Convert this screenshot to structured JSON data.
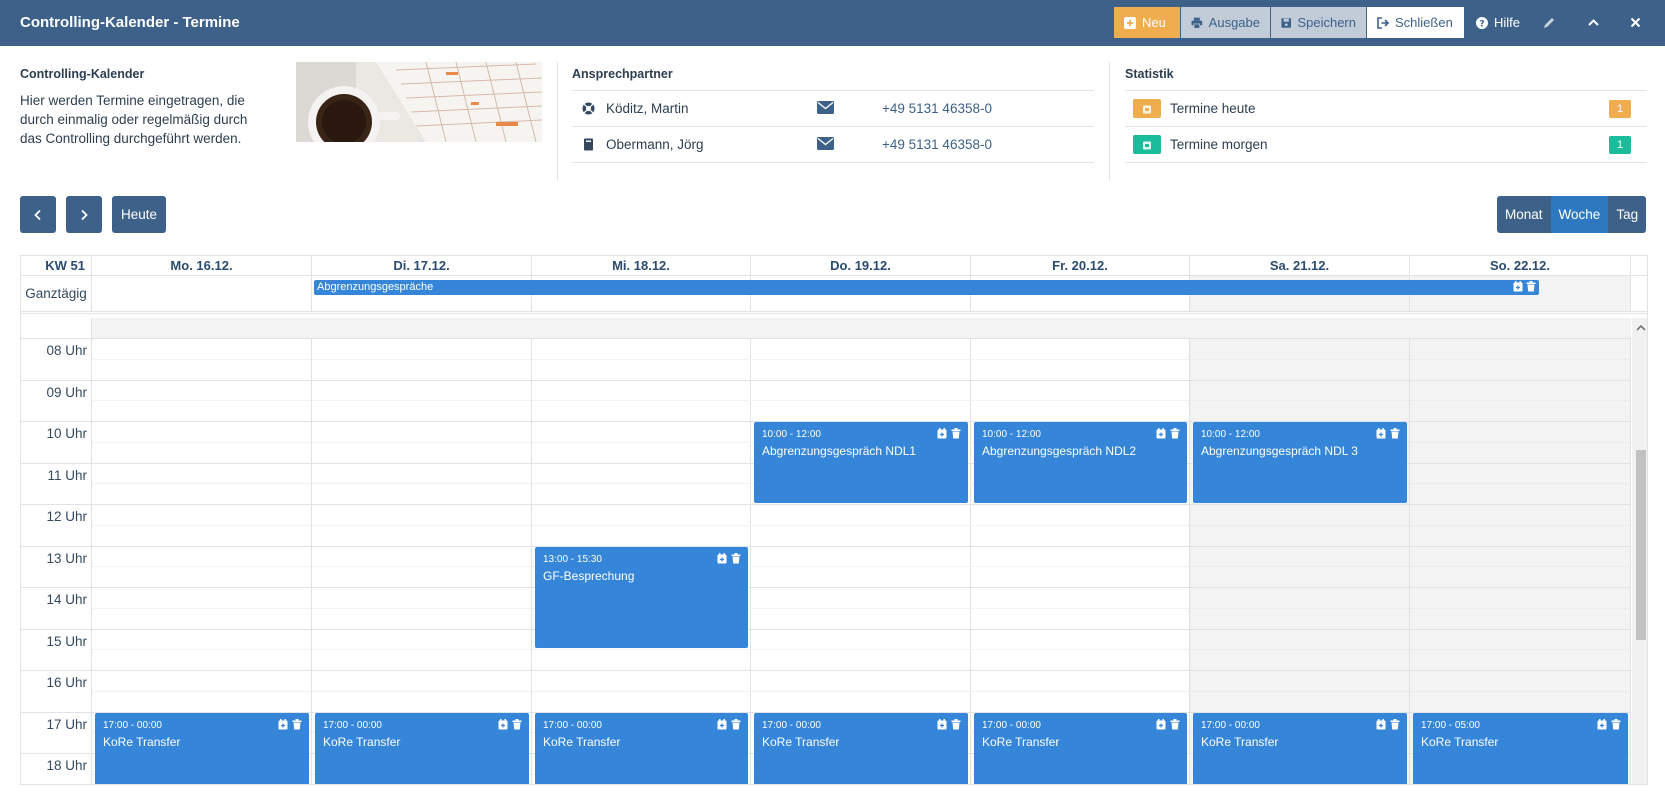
{
  "header": {
    "title": "Controlling-Kalender - Termine",
    "buttons": {
      "neu": "Neu",
      "ausgabe": "Ausgabe",
      "speichern": "Speichern",
      "schliessen": "Schließen",
      "hilfe": "Hilfe"
    }
  },
  "info": {
    "title": "Controlling-Kalender",
    "text": "Hier werden Termine eingetragen, die durch einmalig oder regelmäßig durch das Controlling durchgeführt werden."
  },
  "contacts": {
    "title": "Ansprechpartner",
    "items": [
      {
        "name": "Köditz, Martin",
        "phone": "+49 5131 46358-0",
        "icon": "life-ring-icon"
      },
      {
        "name": "Obermann, Jörg",
        "phone": "+49 5131 46358-0",
        "icon": "book-icon"
      }
    ]
  },
  "stats": {
    "title": "Statistik",
    "items": [
      {
        "label": "Termine heute",
        "count": "1",
        "color": "#f0ad4e"
      },
      {
        "label": "Termine morgen",
        "count": "1",
        "color": "#1abc9c"
      }
    ]
  },
  "nav": {
    "today": "Heute",
    "views": [
      "Monat",
      "Woche",
      "Tag"
    ],
    "active_view": "Woche"
  },
  "calendar": {
    "week_label": "KW 51",
    "days": [
      "Mo. 16.12.",
      "Di. 17.12.",
      "Mi. 18.12.",
      "Do. 19.12.",
      "Fr. 20.12.",
      "Sa. 21.12.",
      "So. 22.12."
    ],
    "allday_label": "Ganztägig",
    "allday_event": "Abgrenzungsgespräche",
    "hours": [
      "08 Uhr",
      "09 Uhr",
      "10 Uhr",
      "11 Uhr",
      "12 Uhr",
      "13 Uhr",
      "14 Uhr",
      "15 Uhr",
      "16 Uhr",
      "17 Uhr",
      "18 Uhr"
    ],
    "events": [
      {
        "day": 3,
        "time": "10:00 - 12:00",
        "title": "Abgrenzungsgespräch NDL1"
      },
      {
        "day": 4,
        "time": "10:00 - 12:00",
        "title": "Abgrenzungsgespräch NDL2"
      },
      {
        "day": 5,
        "time": "10:00 - 12:00",
        "title": "Abgrenzungsgespräch NDL 3"
      },
      {
        "day": 2,
        "time": "13:00 - 15:30",
        "title": "GF-Besprechung"
      },
      {
        "day": 0,
        "time": "17:00 - 00:00",
        "title": "KoRe Transfer"
      },
      {
        "day": 1,
        "time": "17:00 - 00:00",
        "title": "KoRe Transfer"
      },
      {
        "day": 2,
        "time": "17:00 - 00:00",
        "title": "KoRe Transfer"
      },
      {
        "day": 3,
        "time": "17:00 - 00:00",
        "title": "KoRe Transfer"
      },
      {
        "day": 4,
        "time": "17:00 - 00:00",
        "title": "KoRe Transfer"
      },
      {
        "day": 5,
        "time": "17:00 - 00:00",
        "title": "KoRe Transfer"
      },
      {
        "day": 6,
        "time": "17:00 - 05:00",
        "title": "KoRe Transfer"
      }
    ],
    "event_color": "#3586d8"
  }
}
